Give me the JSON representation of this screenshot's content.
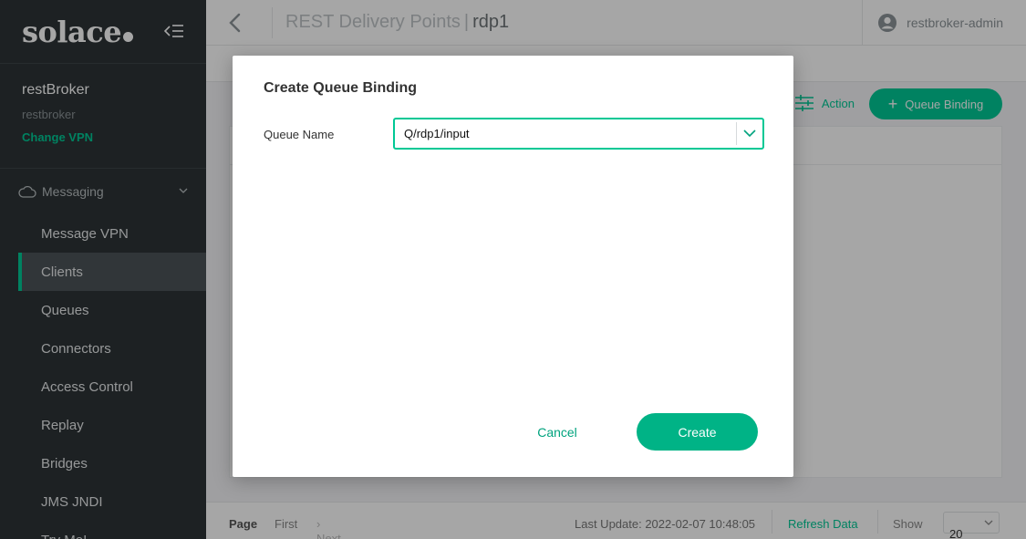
{
  "sidebar": {
    "logo": "solace",
    "vpn": {
      "name": "restBroker",
      "sub": "restbroker",
      "change_label": "Change VPN"
    },
    "section": "Messaging",
    "items": [
      {
        "label": "Message VPN"
      },
      {
        "label": "Clients"
      },
      {
        "label": "Queues"
      },
      {
        "label": "Connectors"
      },
      {
        "label": "Access Control"
      },
      {
        "label": "Replay"
      },
      {
        "label": "Bridges"
      },
      {
        "label": "JMS JNDI"
      },
      {
        "label": "Try Me!"
      }
    ],
    "active_item": "Clients"
  },
  "header": {
    "title": "REST Delivery Points",
    "title_sep": "|",
    "subtitle": "rdp1",
    "user": "restbroker-admin"
  },
  "toolbar": {
    "action_label": "Action",
    "add_label": "Queue Binding"
  },
  "footer": {
    "page_label": "Page",
    "first_label": "First",
    "next_label": "Next",
    "last_update": "Last Update: 2022-02-07 10:48:05",
    "refresh_label": "Refresh Data",
    "show_label": "Show",
    "page_size": "20"
  },
  "modal": {
    "title": "Create Queue Binding",
    "field_label": "Queue Name",
    "field_value": "Q/rdp1/input",
    "cancel_label": "Cancel",
    "create_label": "Create"
  },
  "colors": {
    "accent": "#00c895",
    "sidebar_bg": "#2d3437"
  }
}
